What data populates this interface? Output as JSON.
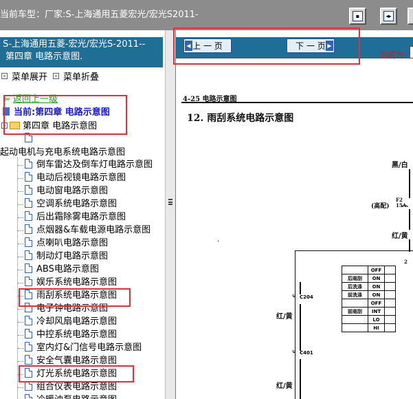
{
  "topbar": {
    "title": "当前车型：厂家:S-上海通用五菱宏光/宏光S2011-",
    "buttons": [
      {
        "icon": "single-pane-icon",
        "glyph": "▪"
      },
      {
        "icon": "split-pane-icon",
        "glyph": "◂▸"
      },
      {
        "icon": "fullscreen-icon",
        "glyph": ""
      }
    ]
  },
  "sidebar": {
    "header_line1": "S-上海通用五菱-宏光/宏光S-2011--",
    "header_line2": "第四章 电路示意图.",
    "expand_label": "菜单展开",
    "collapse_label": "菜单折叠",
    "back_label": "返回上一级",
    "current_label": "当前:第四章 电路示意图",
    "chapter_label": "第四章 电路示意图",
    "group_label": "起动电机与充电系统电路示意图",
    "items": [
      "倒车雷达及倒车灯电路示意图",
      "电动后视镜电路示意图",
      "电动窗电路示意图",
      "空调系统电路示意图",
      "后出霜除雾电路示意图",
      "点烟器&车载电源电路示意图",
      "点喇叭电路示意图",
      "制动灯电路示意图",
      "ABS电路示意图",
      "娱乐系统电路示意图",
      "雨刮系统电路示意图",
      "电子钟电路示意图",
      "冷却风扇电路示意图",
      "中控系统电路示意图",
      "室内灯&门信号电路示意图",
      "安全气囊电路示意图",
      "灯光系统电路示意图",
      "组合仪表电路示意图",
      "冷暖油泵电路示意图"
    ]
  },
  "nav": {
    "prev_label": "上 一 页",
    "next_label": "下 一 页",
    "current_page_label": "当前为"
  },
  "document": {
    "section_header": "4-25 电路示意图",
    "title": "12. 雨刮系统电路示意图",
    "wire_black_white": "黑/白",
    "fuse_label": "(高配)",
    "fuse_id": "F2 15A",
    "wire_red_yellow": "红/黄",
    "connector1": "C204",
    "connector2": "C401",
    "table_header_col": "2",
    "switch_table": {
      "rows": [
        {
          "label": "",
          "pos": "OFF"
        },
        {
          "label": "后雨刮",
          "pos": "ON"
        },
        {
          "label": "后洗涤",
          "pos": "ON"
        },
        {
          "label": "前洗涤",
          "pos": "ON"
        },
        {
          "label": "",
          "pos": "OFF"
        },
        {
          "label": "前雨刮",
          "pos": "INT"
        },
        {
          "label": "",
          "pos": "LO"
        },
        {
          "label": "",
          "pos": "HI"
        }
      ]
    }
  }
}
